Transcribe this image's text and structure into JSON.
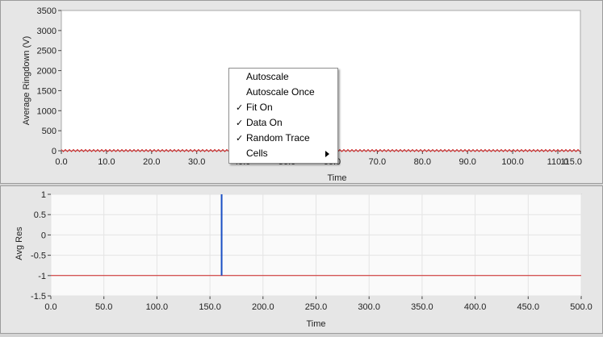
{
  "chart_data": [
    {
      "type": "line",
      "xlabel": "Time",
      "ylabel": "Average Ringdown (V)",
      "xlim": [
        0,
        115
      ],
      "ylim": [
        0,
        3500
      ],
      "x_ticks": [
        "0.0",
        "10.0",
        "20.0",
        "30.0",
        "40.0",
        "50.0",
        "60.0",
        "70.0",
        "80.0",
        "90.0",
        "100.0",
        "110.0",
        "115.0"
      ],
      "y_ticks": [
        "3500",
        "3000",
        "2500",
        "2000",
        "1500",
        "1000",
        "500",
        "0"
      ],
      "series": [
        {
          "color": "#cc2222",
          "style": "small zigzag oscillation near 0",
          "y_approx": 0
        }
      ],
      "background": "#ffffff",
      "grid": false
    },
    {
      "type": "line",
      "xlabel": "Time",
      "ylabel": "Avg Res",
      "xlim": [
        0,
        500
      ],
      "ylim": [
        -1.5,
        1
      ],
      "x_ticks": [
        "0.0",
        "50.0",
        "100.0",
        "150.0",
        "200.0",
        "250.0",
        "300.0",
        "350.0",
        "400.0",
        "450.0",
        "500.0"
      ],
      "y_ticks": [
        "1",
        "0.5",
        "0",
        "-0.5",
        "-1",
        "-1.5"
      ],
      "series": [
        {
          "color": "#cc2222",
          "y_constant": -1
        }
      ],
      "cursor": {
        "color": "#1a4fc4",
        "x": 161
      },
      "background": "#fafafa",
      "grid": true
    }
  ],
  "context_menu": {
    "items": [
      {
        "label": "Autoscale",
        "checked": false,
        "submenu": false
      },
      {
        "label": "Autoscale Once",
        "checked": false,
        "submenu": false
      },
      {
        "label": "Fit On",
        "checked": true,
        "submenu": false
      },
      {
        "label": "Data On",
        "checked": true,
        "submenu": false
      },
      {
        "label": "Random Trace",
        "checked": true,
        "submenu": false
      },
      {
        "label": "Cells",
        "checked": false,
        "submenu": true
      }
    ],
    "check_glyph": "✓"
  }
}
